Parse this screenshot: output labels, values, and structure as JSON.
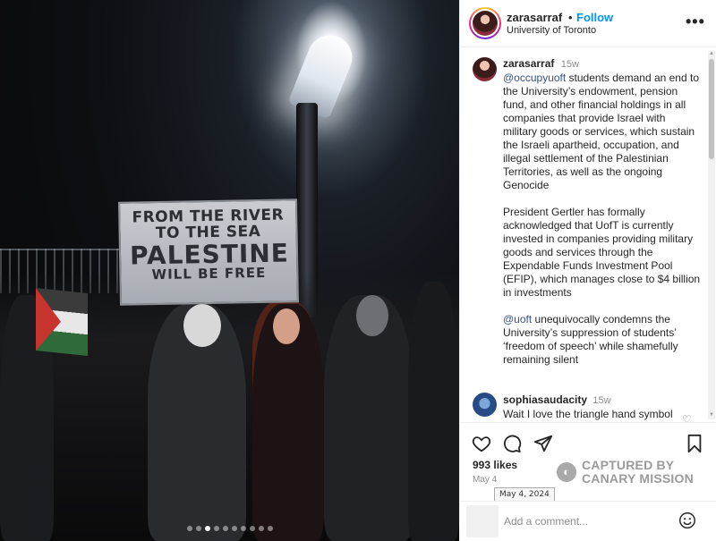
{
  "photo": {
    "sign_lines": [
      "FROM THE RIVER",
      "TO THE SEA",
      "PALESTINE",
      "WILL BE FREE"
    ],
    "carousel": {
      "total": 10,
      "active_index": 2
    }
  },
  "header": {
    "username": "zarasarraf",
    "separator": "•",
    "follow_label": "Follow",
    "location": "University of Toronto",
    "more_label": "•••"
  },
  "caption": {
    "username": "zarasarraf",
    "time": "15w",
    "p1_mention": "@occupyuoft",
    "p1_text": " students demand an end to the University’s endowment, pension fund, and other financial holdings in all companies that provide Israel with military goods or services, which sustain the Israeli apartheid, occupation, and illegal settlement of the Palestinian Territories, as well as the ongoing Genocide",
    "p2_text": "President Gertler has formally acknowledged that UofT is currently invested in companies providing military goods and services through the Expendable Funds Investment Pool (EFIP), which manages close to $4 billion in investments",
    "p3_mention": "@uoft",
    "p3_text": " unequivocally condemns the University’s suppression of students’ ‘freedom of speech’ while shamefully remaining silent"
  },
  "comment": {
    "username": "sophiasaudacity",
    "time": "15w",
    "text": "Wait I love the triangle hand symbol"
  },
  "actions": {
    "icons": [
      "heart-icon",
      "comment-icon",
      "share-icon",
      "bookmark-icon"
    ]
  },
  "likes": "993 likes",
  "date": "May 4",
  "tooltip": "May 4, 2024",
  "watermark": {
    "line1": "CAPTURED BY",
    "line2": "CANARY MISSION"
  },
  "add_comment": {
    "placeholder": "Add a comment..."
  }
}
